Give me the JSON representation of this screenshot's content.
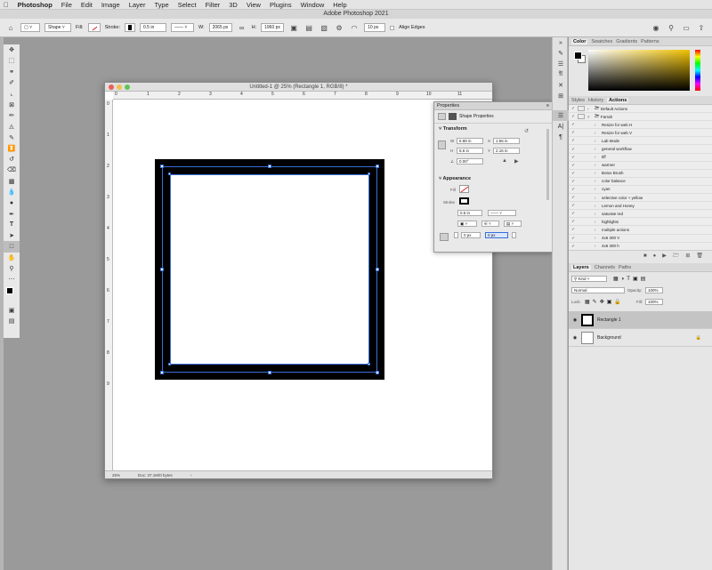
{
  "menubar": {
    "apple_icon": "apple-icon",
    "items": [
      "Photoshop",
      "File",
      "Edit",
      "Image",
      "Layer",
      "Type",
      "Select",
      "Filter",
      "3D",
      "View",
      "Plugins",
      "Window",
      "Help"
    ]
  },
  "window_title": "Adobe Photoshop 2021",
  "options": {
    "tool_mode": "Shape",
    "fill_label": "Fill:",
    "stroke_label": "Stroke:",
    "stroke_width": "0.5 in",
    "w_label": "W:",
    "w_value": "2065 px",
    "h_label": "H:",
    "h_value": "1960 px",
    "radius_value": "10 px",
    "align_edges": "Align Edges"
  },
  "document": {
    "title": "Untitled-1 @ 25% (Rectangle 1, RGB/8) *",
    "zoom": "25%",
    "doc_info": "Doc: 37.1M/0 bytes",
    "ruler_h": [
      "0",
      "1",
      "2",
      "3",
      "4",
      "5",
      "6",
      "7",
      "8",
      "9",
      "10",
      "11"
    ],
    "ruler_v": [
      "0",
      "1",
      "2",
      "3",
      "4",
      "5",
      "6",
      "7",
      "8",
      "9"
    ]
  },
  "properties": {
    "tab": "Properties",
    "kind": "Shape Properties",
    "transform_label": "Transform",
    "w_label": "W",
    "w": "6.88 in",
    "x_label": "X",
    "x": "1.56 in",
    "h_label": "H",
    "h": "6.6 in",
    "y_label": "Y",
    "y": "2.16 in",
    "angle": "0.00°",
    "appearance_label": "Appearance",
    "fill_label": "Fill",
    "stroke_label": "Stroke",
    "stroke_width": "0.5 in",
    "corner_1": "0 px",
    "corner_2": "0 px"
  },
  "color_panel": {
    "tabs": [
      "Color",
      "Swatches",
      "Gradients",
      "Patterns"
    ]
  },
  "actions_panel": {
    "tabs": [
      "Styles",
      "History",
      "Actions"
    ],
    "items": [
      {
        "label": "Default Actions",
        "type": "set"
      },
      {
        "label": "Farrah",
        "type": "set-open"
      },
      {
        "label": "Resize for web H",
        "type": "action"
      },
      {
        "label": "Resize for web V",
        "type": "action"
      },
      {
        "label": "Lab Mode",
        "type": "action"
      },
      {
        "label": "general workflow",
        "type": "action"
      },
      {
        "label": "tiff",
        "type": "action"
      },
      {
        "label": "warmer",
        "type": "action"
      },
      {
        "label": "Botox Brush",
        "type": "action"
      },
      {
        "label": "color balance",
        "type": "action"
      },
      {
        "label": "cyan",
        "type": "action"
      },
      {
        "label": "selective color + yellow",
        "type": "action"
      },
      {
        "label": "Lemon and Honey",
        "type": "action"
      },
      {
        "label": "saturate red",
        "type": "action"
      },
      {
        "label": "highlights",
        "type": "action"
      },
      {
        "label": "multiple actions",
        "type": "action"
      },
      {
        "label": "4x6 300 V",
        "type": "action"
      },
      {
        "label": "4x6 300 h",
        "type": "action"
      }
    ]
  },
  "layers_panel": {
    "tabs": [
      "Layers",
      "Channels",
      "Paths"
    ],
    "kind": "Kind",
    "blend_mode": "Normal",
    "opacity_label": "Opacity:",
    "opacity": "100%",
    "lock_label": "Lock:",
    "fill_label": "Fill:",
    "fill": "100%",
    "layers": [
      {
        "name": "Rectangle 1",
        "selected": true
      },
      {
        "name": "Background",
        "selected": false
      }
    ]
  },
  "colors": {
    "accent_handle": "#3a6fd8",
    "stroke": "#000000",
    "fill_none": "#d62020"
  }
}
